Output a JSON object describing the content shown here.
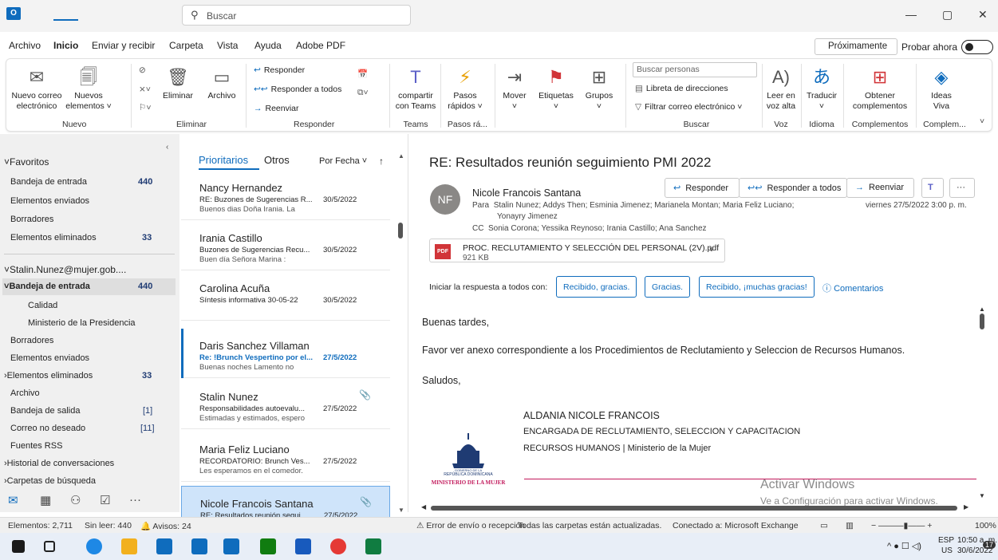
{
  "titlebar": {
    "app_icon": "O",
    "search_placeholder": "Buscar",
    "min": "—",
    "restore": "▢",
    "close": "✕"
  },
  "menu": {
    "items": [
      "Archivo",
      "Inicio",
      "Enviar y recibir",
      "Carpeta",
      "Vista",
      "Ayuda",
      "Adobe PDF"
    ],
    "proximamente": "Próximamente",
    "probar": "Probar ahora"
  },
  "ribbon": {
    "nuevo_correo": "Nuevo correo",
    "electronico": "electrónico",
    "nuevos": "Nuevos",
    "elementos": "elementos ˅",
    "eliminar": "Eliminar",
    "archivo": "Archivo",
    "responder": "Responder",
    "responder_todos": "Responder a todos",
    "reenviar": "Reenviar",
    "compartir": "compartir",
    "con_teams": "con Teams",
    "pasos": "Pasos",
    "rapidos": "rápidos ˅",
    "mover": "Mover",
    "etiquetas": "Etiquetas",
    "grupos": "Grupos",
    "buscar_personas": "Buscar personas",
    "libreta": "Libreta de direcciones",
    "filtrar": "Filtrar correo electrónico ˅",
    "leer_en": "Leer en",
    "voz_alta": "voz alta",
    "traducir": "Traducir",
    "obtener": "Obtener",
    "complementos": "complementos",
    "ideas": "Ideas",
    "viva": "Viva",
    "groups": {
      "nuevo": "Nuevo",
      "eliminar": "Eliminar",
      "responder": "Responder",
      "teams": "Teams",
      "pasos": "Pasos rá...",
      "buscar": "Buscar",
      "voz": "Voz",
      "idioma": "Idioma",
      "complementos": "Complementos",
      "complem": "Complem..."
    }
  },
  "nav": {
    "favoritos": "Favoritos",
    "fav_items": [
      {
        "label": "Bandeja de entrada",
        "count": "440"
      },
      {
        "label": "Elementos enviados",
        "count": ""
      },
      {
        "label": "Borradores",
        "count": ""
      },
      {
        "label": "Elementos eliminados",
        "count": "33"
      }
    ],
    "account": "Stalin.Nunez@mujer.gob....",
    "folders": [
      {
        "label": "Bandeja de entrada",
        "count": "440"
      },
      {
        "label": "Calidad",
        "count": ""
      },
      {
        "label": "Ministerio de la Presidencia",
        "count": ""
      },
      {
        "label": "Borradores",
        "count": ""
      },
      {
        "label": "Elementos enviados",
        "count": ""
      },
      {
        "label": "Elementos eliminados",
        "count": "33"
      },
      {
        "label": "Archivo",
        "count": ""
      },
      {
        "label": "Bandeja de salida",
        "count": "[1]"
      },
      {
        "label": "Correo no deseado",
        "count": "[11]"
      },
      {
        "label": "Fuentes RSS",
        "count": ""
      },
      {
        "label": "Historial de conversaciones",
        "count": ""
      },
      {
        "label": "Carpetas de búsqueda",
        "count": ""
      }
    ]
  },
  "list": {
    "tab_prioritarios": "Prioritarios",
    "tab_otros": "Otros",
    "sort": "Por Fecha ˅",
    "sort_arrow": "↑",
    "messages": [
      {
        "sender": "Nancy Hernandez",
        "subject": "RE: Buzones de Sugerencias R...",
        "date": "30/5/2022",
        "preview": "Buenos dias Doña Irania.  La"
      },
      {
        "sender": "Irania Castillo",
        "subject": "Buzones de Sugerencias Recu...",
        "date": "30/5/2022",
        "preview": "Buen día Señora Marina :"
      },
      {
        "sender": "Carolina Acuña",
        "subject": "Síntesis informativa 30-05-22",
        "date": "30/5/2022",
        "preview": ""
      },
      {
        "sender": "Daris Sanchez Villaman",
        "subject": "Re: !Brunch Vespertino por el...",
        "date": "27/5/2022",
        "preview": "Buenas noches  Lamento no"
      },
      {
        "sender": "Stalin Nunez",
        "subject": "Responsabilidades autoevalu...",
        "date": "27/5/2022",
        "preview": "Estimadas y estimados, espero"
      },
      {
        "sender": "Maria Feliz Luciano",
        "subject": "RECORDATORIO: Brunch Ves...",
        "date": "27/5/2022",
        "preview": "Les esperamos en el comedor."
      },
      {
        "sender": "Nicole Francois Santana",
        "subject": "RE: Resultados reunión segui...",
        "date": "27/5/2022",
        "preview": ""
      }
    ]
  },
  "reading": {
    "subject": "RE: Resultados reunión seguimiento PMI 2022",
    "avatar": "NF",
    "from": "Nicole Francois Santana",
    "para_label": "Para",
    "para": "Stalin Nunez; Addys Then; Esminia Jimenez; Marianela Montan; Maria Feliz Luciano;",
    "para2": "Yonayry Jimenez",
    "cc_label": "CC",
    "cc": "Sonia Corona; Yessika Reynoso; Irania Castillo; Ana Sanchez",
    "datetime": "viernes 27/5/2022 3:00 p. m.",
    "btn_responder": "Responder",
    "btn_responder_todos": "Responder a todos",
    "btn_reenviar": "Reenviar",
    "attachment_name": "PROC. RECLUTAMIENTO Y SELECCIÓN DEL PERSONAL (2V).pdf",
    "attachment_size": "921 KB",
    "pdf": "PDF",
    "quick_label": "Iniciar la respuesta a todos con:",
    "quick1": "Recibido, gracias.",
    "quick2": "Gracias.",
    "quick3": "Recibido, ¡muchas gracias!",
    "comentarios": "Comentarios",
    "body1": "Buenas tardes,",
    "body2": "Favor ver anexo correspondiente a los Procedimientos de Reclutamiento y Seleccion de Recursos Humanos.",
    "body3": "Saludos,",
    "sig_name": "ALDANIA NICOLE FRANCOIS",
    "sig_title": "ENCARGADA DE RECLUTAMIENTO, SELECCION Y CAPACITACION",
    "sig_dept": "RECURSOS HUMANOS | Ministerio de la Mujer",
    "seal_line1": "GOBIERNO DE LA",
    "seal_line2": "REPÚBLICA DOMINICANA",
    "seal_line3": "MINISTERIO DE LA MUJER",
    "wm1": "Activar Windows",
    "wm2": "Ve a Configuración para activar Windows."
  },
  "status": {
    "elementos": "Elementos: 2,711",
    "sin_leer": "Sin leer: 440",
    "avisos": "Avisos: 24",
    "error": "Error de envío o recepción",
    "carpetas": "Todas las carpetas están actualizadas.",
    "conectado": "Conectado a: Microsoft Exchange",
    "zoom": "100%"
  },
  "taskbar": {
    "lang1": "ESP",
    "lang2": "US",
    "time": "10:50 a. m.",
    "date": "30/6/2022",
    "notif": "17"
  }
}
